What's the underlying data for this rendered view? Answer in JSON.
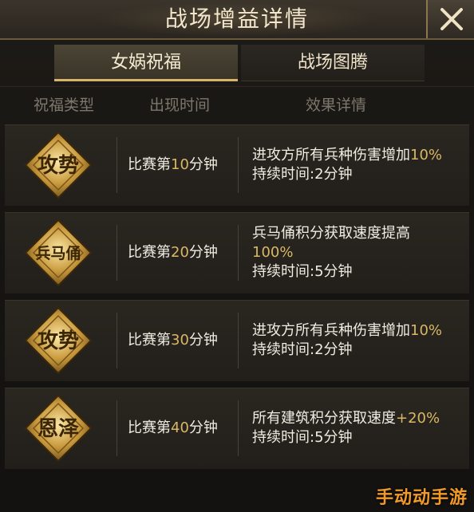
{
  "window": {
    "title": "战场增益详情"
  },
  "tabs": [
    {
      "label": "女娲祝福",
      "active": true
    },
    {
      "label": "战场图腾",
      "active": false
    }
  ],
  "table": {
    "headers": [
      "祝福类型",
      "出现时间",
      "效果详情"
    ],
    "rows": [
      {
        "emblem_text": "攻势",
        "time_prefix": "比赛第",
        "time_num": "10",
        "time_suffix": "分钟",
        "effect_line1_text": "进攻方所有兵种伤害增加",
        "effect_line1_value": "10%",
        "effect_line2": "持续时间:2分钟"
      },
      {
        "emblem_text": "兵马俑",
        "time_prefix": "比赛第",
        "time_num": "20",
        "time_suffix": "分钟",
        "effect_line1_text": "兵马俑积分获取速度提高",
        "effect_line1_value": "100%",
        "effect_line2": "持续时间:5分钟"
      },
      {
        "emblem_text": "攻势",
        "time_prefix": "比赛第",
        "time_num": "30",
        "time_suffix": "分钟",
        "effect_line1_text": "进攻方所有兵种伤害增加",
        "effect_line1_value": "10%",
        "effect_line2": "持续时间:2分钟"
      },
      {
        "emblem_text": "恩泽",
        "time_prefix": "比赛第",
        "time_num": "40",
        "time_suffix": "分钟",
        "effect_line1_text": "所有建筑积分获取速度",
        "effect_line1_value": "+20%",
        "effect_line2": "持续时间:5分钟"
      }
    ]
  },
  "watermark": "手动动手游",
  "colors": {
    "accent_gold": "#d9b765",
    "text_light": "#f1ece2",
    "header_muted": "#7d766a",
    "watermark": "#f19a2a"
  },
  "icons": {
    "close": "close-icon",
    "emblem": "diamond-emblem-icon"
  }
}
